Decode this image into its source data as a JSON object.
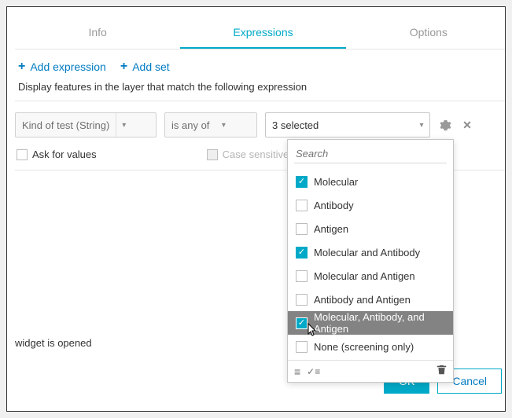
{
  "tabs": {
    "info": "Info",
    "expressions": "Expressions",
    "options": "Options"
  },
  "toolbar": {
    "add_expression": "Add expression",
    "add_set": "Add set"
  },
  "desc": "Display features in the layer that match the following expression",
  "expr": {
    "field_label": "Kind of test (String)",
    "operator_label": "is any of",
    "value_label": "3 selected"
  },
  "checks": {
    "ask": "Ask for values",
    "case": "Case sensitive"
  },
  "footer_text": "widget is opened",
  "buttons": {
    "ok": "OK",
    "cancel": "Cancel"
  },
  "dropdown": {
    "search_placeholder": "Search",
    "options": [
      {
        "label": "Molecular",
        "checked": true
      },
      {
        "label": "Antibody",
        "checked": false
      },
      {
        "label": "Antigen",
        "checked": false
      },
      {
        "label": "Molecular and Antibody",
        "checked": true
      },
      {
        "label": "Molecular and Antigen",
        "checked": false
      },
      {
        "label": "Antibody and Antigen",
        "checked": false
      },
      {
        "label": "Molecular, Antibody, and Antigen",
        "checked": true,
        "hover": true
      },
      {
        "label": "None (screening only)",
        "checked": false
      }
    ]
  }
}
